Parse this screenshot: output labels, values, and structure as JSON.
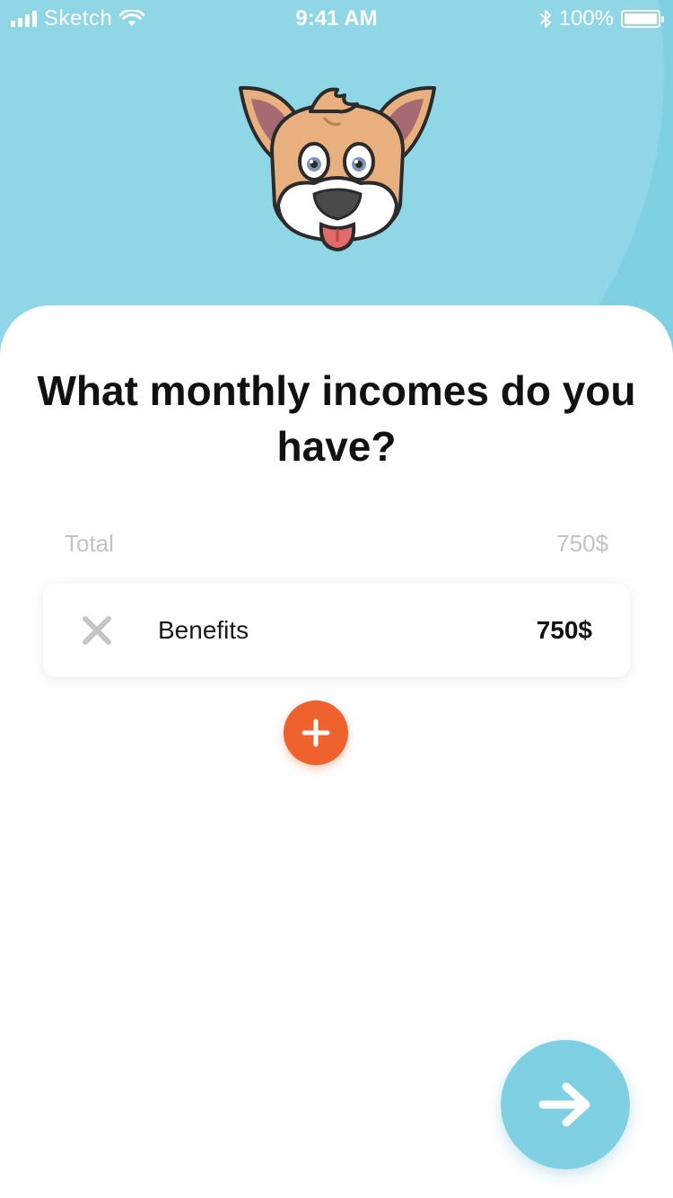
{
  "status_bar": {
    "carrier": "Sketch",
    "time": "9:41 AM",
    "battery_label": "100%",
    "battery_level": 1.0
  },
  "mascot": {
    "icon": "dog-face-icon"
  },
  "question": {
    "title": "What monthly incomes do you have?"
  },
  "total": {
    "label": "Total",
    "value": "750$"
  },
  "incomes": [
    {
      "label": "Benefits",
      "amount": "750$",
      "remove_icon": "close-icon"
    }
  ],
  "actions": {
    "add_icon": "plus-icon",
    "next_icon": "arrow-right-icon"
  },
  "colors": {
    "header_bg": "#7fd0e3",
    "accent_orange": "#f0622d",
    "text_primary": "#111111",
    "text_muted": "#c3c3c3"
  }
}
